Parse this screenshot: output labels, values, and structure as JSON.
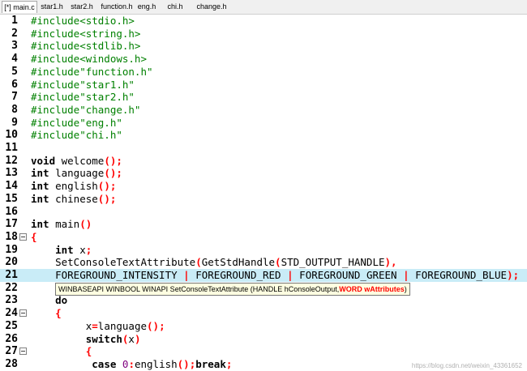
{
  "tabs": [
    {
      "label": "[*] main.c",
      "active": true
    },
    {
      "label": "star1.h",
      "active": false
    },
    {
      "label": "star2.h",
      "active": false
    },
    {
      "label": "function.h",
      "active": false
    },
    {
      "label": "eng.h",
      "active": false
    },
    {
      "label": "chi.h",
      "active": false
    },
    {
      "label": "change.h",
      "active": false
    }
  ],
  "lines": [
    {
      "n": "1",
      "tokens": [
        [
          "pp",
          "#include<stdio.h>"
        ]
      ]
    },
    {
      "n": "2",
      "tokens": [
        [
          "pp",
          "#include<string.h>"
        ]
      ]
    },
    {
      "n": "3",
      "tokens": [
        [
          "pp",
          "#include<stdlib.h>"
        ]
      ]
    },
    {
      "n": "4",
      "tokens": [
        [
          "pp",
          "#include<windows.h>"
        ]
      ]
    },
    {
      "n": "5",
      "tokens": [
        [
          "pp",
          "#include\"function.h\""
        ]
      ]
    },
    {
      "n": "6",
      "tokens": [
        [
          "pp",
          "#include\"star1.h\""
        ]
      ]
    },
    {
      "n": "7",
      "tokens": [
        [
          "pp",
          "#include\"star2.h\""
        ]
      ]
    },
    {
      "n": "8",
      "tokens": [
        [
          "pp",
          "#include\"change.h\""
        ]
      ]
    },
    {
      "n": "9",
      "tokens": [
        [
          "pp",
          "#include\"eng.h\""
        ]
      ]
    },
    {
      "n": "10",
      "tokens": [
        [
          "pp",
          "#include\"chi.h\""
        ]
      ]
    },
    {
      "n": "11",
      "tokens": []
    },
    {
      "n": "12",
      "tokens": [
        [
          "kw",
          "void"
        ],
        [
          "",
          " welcome"
        ],
        [
          "sym",
          "();"
        ]
      ]
    },
    {
      "n": "13",
      "tokens": [
        [
          "kw",
          "int"
        ],
        [
          "",
          " language"
        ],
        [
          "sym",
          "();"
        ]
      ]
    },
    {
      "n": "14",
      "tokens": [
        [
          "kw",
          "int"
        ],
        [
          "",
          " english"
        ],
        [
          "sym",
          "();"
        ]
      ]
    },
    {
      "n": "15",
      "tokens": [
        [
          "kw",
          "int"
        ],
        [
          "",
          " chinese"
        ],
        [
          "sym",
          "();"
        ]
      ]
    },
    {
      "n": "16",
      "tokens": []
    },
    {
      "n": "17",
      "tokens": [
        [
          "kw",
          "int"
        ],
        [
          "",
          " main"
        ],
        [
          "sym",
          "()"
        ]
      ]
    },
    {
      "n": "18",
      "fold": true,
      "tokens": [
        [
          "sym",
          "{"
        ]
      ]
    },
    {
      "n": "19",
      "tokens": [
        [
          "",
          "    "
        ],
        [
          "kw",
          "int"
        ],
        [
          "",
          " x"
        ],
        [
          "sym",
          ";"
        ]
      ]
    },
    {
      "n": "20",
      "tokens": [
        [
          "",
          "    SetConsoleTextAttribute"
        ],
        [
          "sym",
          "("
        ],
        [
          "",
          "GetStdHandle"
        ],
        [
          "sym",
          "("
        ],
        [
          "",
          "STD_OUTPUT_HANDLE"
        ],
        [
          "sym",
          "),"
        ]
      ]
    },
    {
      "n": "21",
      "hl": true,
      "tokens": [
        [
          "",
          "    FOREGROUND_INTENSITY "
        ],
        [
          "sym",
          "|"
        ],
        [
          "",
          " FOREGROUND_RED "
        ],
        [
          "sym",
          "|"
        ],
        [
          "",
          " FOREGROUND_GREEN "
        ],
        [
          "sym",
          "|"
        ],
        [
          "",
          " FOREGROUND_BLUE"
        ],
        [
          "sym",
          ");"
        ]
      ]
    },
    {
      "n": "22",
      "tokens": []
    },
    {
      "n": "23",
      "tokens": [
        [
          "",
          "    "
        ],
        [
          "kw",
          "do"
        ]
      ]
    },
    {
      "n": "24",
      "fold": true,
      "tokens": [
        [
          "",
          "    "
        ],
        [
          "sym",
          "{"
        ]
      ]
    },
    {
      "n": "25",
      "tokens": [
        [
          "",
          "         x"
        ],
        [
          "sym",
          "="
        ],
        [
          "",
          "language"
        ],
        [
          "sym",
          "();"
        ]
      ]
    },
    {
      "n": "26",
      "tokens": [
        [
          "",
          "         "
        ],
        [
          "kw",
          "switch"
        ],
        [
          "sym",
          "("
        ],
        [
          "",
          "x"
        ],
        [
          "sym",
          ")"
        ]
      ]
    },
    {
      "n": "27",
      "fold": true,
      "tokens": [
        [
          "",
          "         "
        ],
        [
          "sym",
          "{"
        ]
      ]
    },
    {
      "n": "28",
      "tokens": [
        [
          "",
          "          "
        ],
        [
          "kw",
          "case"
        ],
        [
          "",
          " "
        ],
        [
          "num-lit",
          "0"
        ],
        [
          "sym",
          ":"
        ],
        [
          "",
          "english"
        ],
        [
          "sym",
          "();"
        ],
        [
          "kw",
          "break"
        ],
        [
          "sym",
          ";"
        ]
      ]
    }
  ],
  "tooltip": {
    "prefix": "WINBASEAPI WINBOOL WINAPI SetConsoleTextAttribute (HANDLE hConsoleOutput,",
    "current": "WORD wAttributes",
    "suffix": ")"
  },
  "watermark": "https://blog.csdn.net/weixin_43361652"
}
